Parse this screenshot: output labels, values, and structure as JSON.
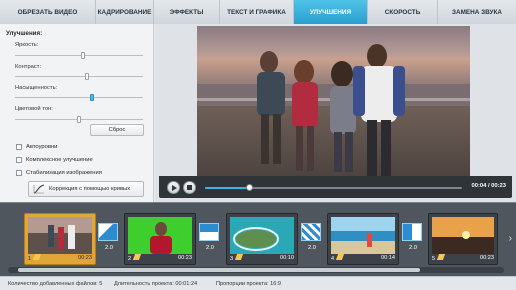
{
  "tabs": [
    {
      "label": "ОБРЕЗАТЬ ВИДЕО"
    },
    {
      "label": "КАДРИРОВАНИЕ"
    },
    {
      "label": "ЭФФЕКТЫ"
    },
    {
      "label": "ТЕКСТ И ГРАФИКА"
    },
    {
      "label": "УЛУЧШЕНИЯ",
      "active": true
    },
    {
      "label": "СКОРОСТЬ"
    },
    {
      "label": "ЗАМЕНА ЗВУКА"
    }
  ],
  "enhance": {
    "title": "Улучшения:",
    "sliders": [
      {
        "label": "Яркость:",
        "value": 0.53
      },
      {
        "label": "Контраст:",
        "value": 0.56
      },
      {
        "label": "Насыщенность:",
        "value": 0.6
      },
      {
        "label": "Цветовой тон:",
        "value": 0.5
      }
    ],
    "reset_label": "Сброс",
    "checkboxes": [
      {
        "label": "Автоуровни",
        "checked": false
      },
      {
        "label": "Комплексное улучшение",
        "checked": false
      },
      {
        "label": "Стабилизация изображения",
        "checked": false
      }
    ],
    "curves_label": "Коррекция с помощью кривых"
  },
  "player": {
    "time": "00:04 / 00:23",
    "progress": 0.17
  },
  "timeline": {
    "clips": [
      {
        "number": "1",
        "duration": "00:23",
        "selected": true
      },
      {
        "number": "2",
        "duration": "00:23",
        "selected": false
      },
      {
        "number": "3",
        "duration": "00:10",
        "selected": false
      },
      {
        "number": "4",
        "duration": "00:14",
        "selected": false
      },
      {
        "number": "5",
        "duration": "00:23",
        "selected": false
      }
    ],
    "transitions": [
      {
        "label": "2.0"
      },
      {
        "label": "2.0"
      },
      {
        "label": "2.0"
      },
      {
        "label": "2.0"
      }
    ]
  },
  "status": {
    "files": "Количество добавленных файлов: 5",
    "duration": "Длительность проекта: 00:01:24",
    "ratio": "Пропорции проекта: 16:9"
  },
  "colors": {
    "accent": "#2a9fd0",
    "selected_clip": "#e0a63a"
  }
}
